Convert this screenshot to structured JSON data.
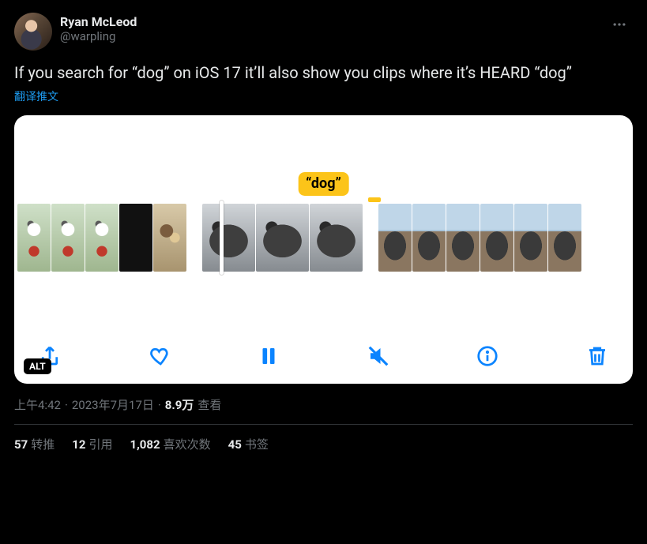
{
  "author": {
    "display_name": "Ryan McLeod",
    "handle": "@warpling"
  },
  "tweet_text": "If you search for “dog” on iOS 17 it’ll also show you clips where it’s HEARD “dog”",
  "translate_label": "翻译推文",
  "media": {
    "search_tag": "“dog”",
    "alt_badge": "ALT"
  },
  "meta": {
    "time": "上午4:42",
    "date": "2023年7月17日",
    "dot": " · ",
    "views_count": "8.9万",
    "views_label": " 查看"
  },
  "stats": {
    "retweets": {
      "count": "57",
      "label": "转推"
    },
    "quotes": {
      "count": "12",
      "label": "引用"
    },
    "likes": {
      "count": "1,082",
      "label": "喜欢次数"
    },
    "bookmarks": {
      "count": "45",
      "label": "书签"
    }
  }
}
